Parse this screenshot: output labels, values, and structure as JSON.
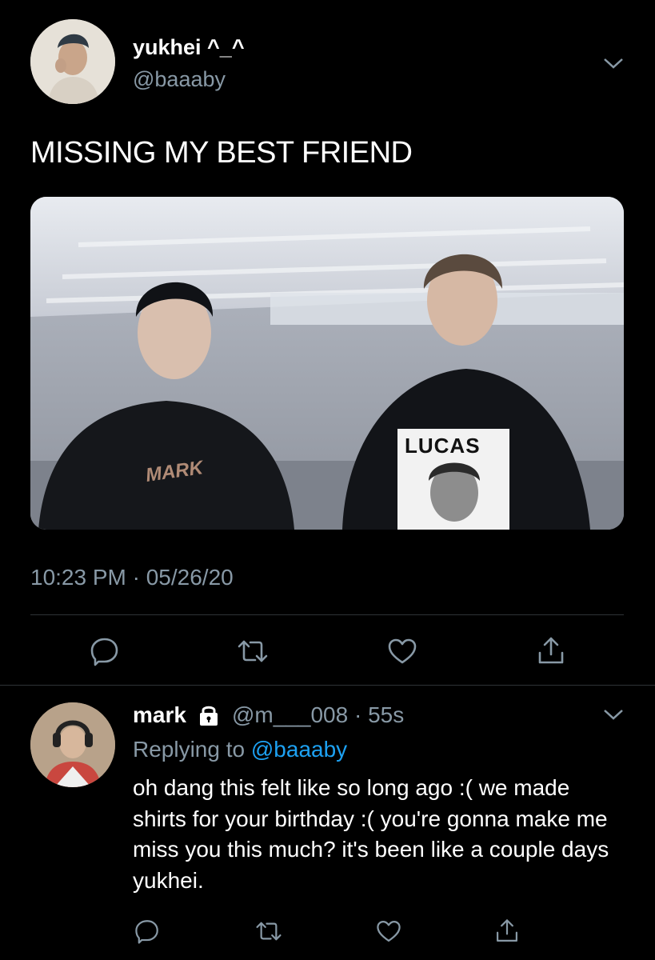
{
  "tweet": {
    "display_name": "yukhei ^_^",
    "handle": "@baaaby",
    "text": "MISSING MY BEST FRIEND",
    "timestamp": "10:23 PM · 05/26/20",
    "media": {
      "shirt_left": "MARK",
      "shirt_right": "LUCAS"
    }
  },
  "actions": [
    "reply-icon",
    "retweet-icon",
    "like-icon",
    "share-icon"
  ],
  "reply": {
    "display_name": "mark",
    "handle_time": "@m___008 · 55s",
    "replying_prefix": "Replying to ",
    "replying_to": "@baaaby",
    "text": "oh dang this felt like so long ago :( we made shirts for your birthday :( you're gonna make me miss you this much? it's been like a couple days yukhei."
  },
  "colors": {
    "background": "#000000",
    "secondary_text": "#8899a6",
    "link": "#1da1f2",
    "divider": "#2f3336"
  }
}
